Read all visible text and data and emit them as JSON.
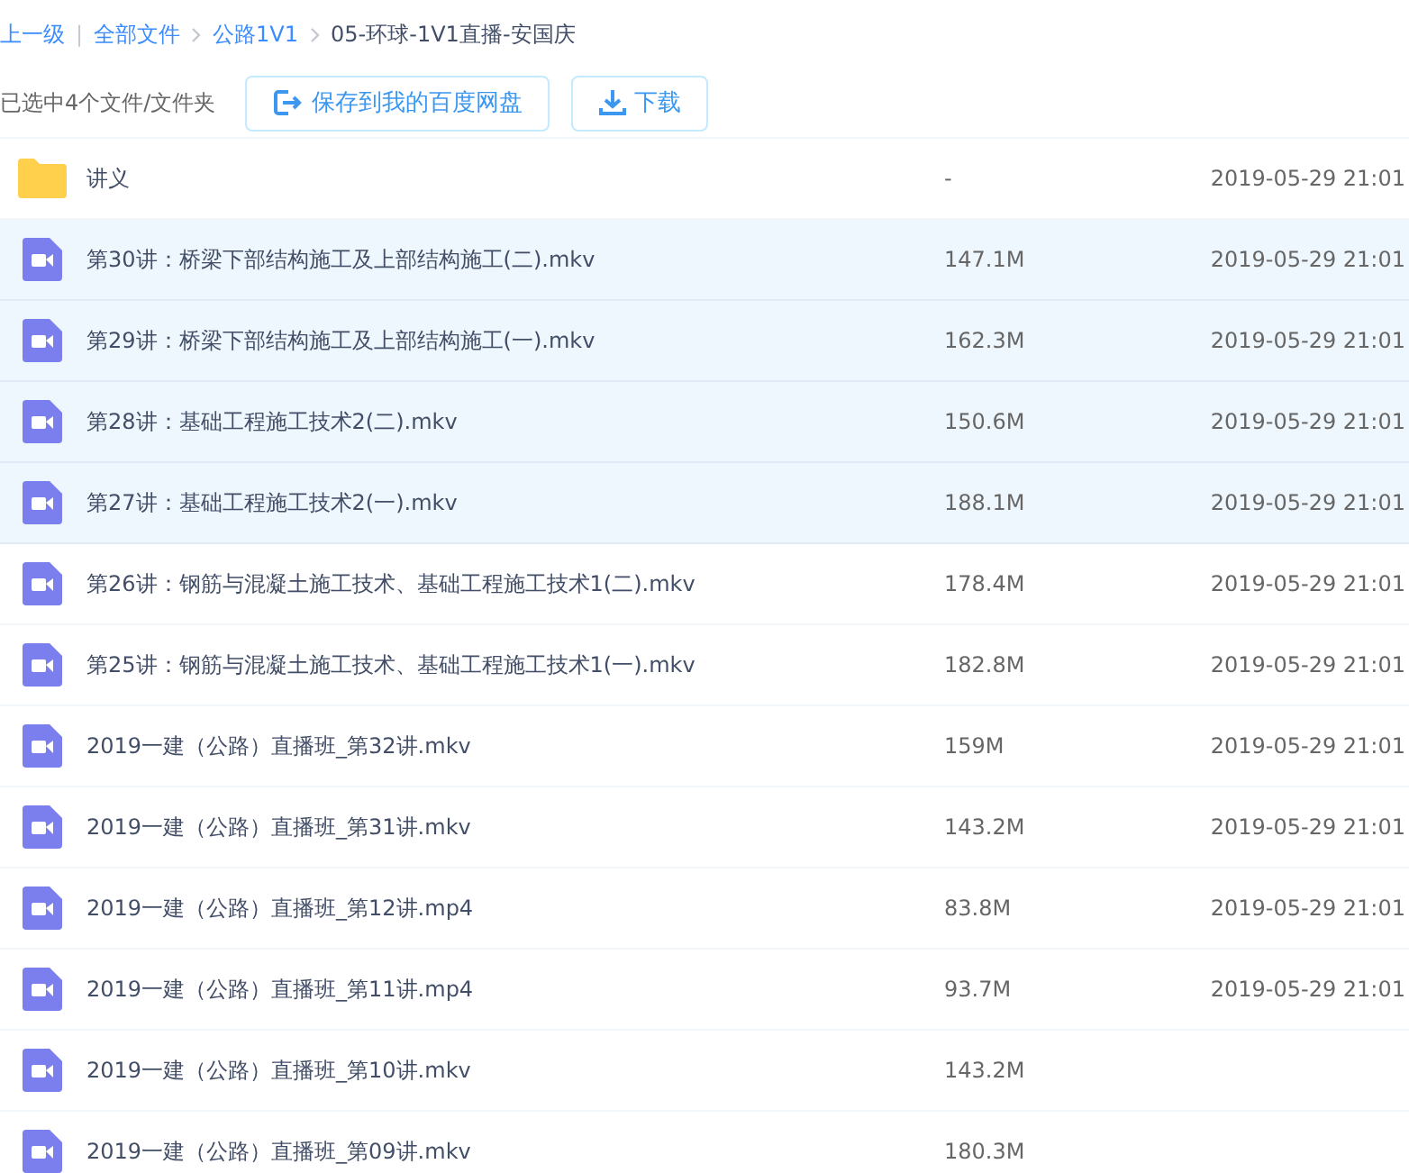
{
  "breadcrumb": {
    "back": "上一级",
    "separator": "|",
    "items": [
      {
        "label": "全部文件",
        "kind": "link"
      },
      {
        "label": "公路1V1",
        "kind": "link"
      },
      {
        "label": "05-环球-1V1直播-安国庆",
        "kind": "current"
      }
    ]
  },
  "toolbar": {
    "selection_info": "已选中4个文件/文件夹",
    "buttons": [
      {
        "label": "保存到我的百度网盘",
        "kind": "save"
      },
      {
        "label": "下载",
        "kind": "download"
      }
    ]
  },
  "files": [
    {
      "kind": "folder",
      "name": "讲义",
      "size": "-",
      "date": "2019-05-29 21:01",
      "selected": false
    },
    {
      "kind": "video",
      "name": "第30讲：桥梁下部结构施工及上部结构施工(二).mkv",
      "size": "147.1M",
      "date": "2019-05-29 21:01",
      "selected": true
    },
    {
      "kind": "video",
      "name": "第29讲：桥梁下部结构施工及上部结构施工(一).mkv",
      "size": "162.3M",
      "date": "2019-05-29 21:01",
      "selected": true
    },
    {
      "kind": "video",
      "name": "第28讲：基础工程施工技术2(二).mkv",
      "size": "150.6M",
      "date": "2019-05-29 21:01",
      "selected": true
    },
    {
      "kind": "video",
      "name": "第27讲：基础工程施工技术2(一).mkv",
      "size": "188.1M",
      "date": "2019-05-29 21:01",
      "selected": true
    },
    {
      "kind": "video",
      "name": "第26讲：钢筋与混凝土施工技术、基础工程施工技术1(二).mkv",
      "size": "178.4M",
      "date": "2019-05-29 21:01",
      "selected": false
    },
    {
      "kind": "video",
      "name": "第25讲：钢筋与混凝土施工技术、基础工程施工技术1(一).mkv",
      "size": "182.8M",
      "date": "2019-05-29 21:01",
      "selected": false
    },
    {
      "kind": "video",
      "name": "2019一建（公路）直播班_第32讲.mkv",
      "size": "159M",
      "date": "2019-05-29 21:01",
      "selected": false
    },
    {
      "kind": "video",
      "name": "2019一建（公路）直播班_第31讲.mkv",
      "size": "143.2M",
      "date": "2019-05-29 21:01",
      "selected": false
    },
    {
      "kind": "video",
      "name": "2019一建（公路）直播班_第12讲.mp4",
      "size": "83.8M",
      "date": "2019-05-29 21:01",
      "selected": false
    },
    {
      "kind": "video",
      "name": "2019一建（公路）直播班_第11讲.mp4",
      "size": "93.7M",
      "date": "2019-05-29 21:01",
      "selected": false
    },
    {
      "kind": "video",
      "name": "2019一建（公路）直播班_第10讲.mkv",
      "size": "143.2M",
      "selected": false
    },
    {
      "kind": "video",
      "name": "2019一建（公路）直播班_第09讲.mkv",
      "size": "180.3M",
      "selected": false
    }
  ]
}
